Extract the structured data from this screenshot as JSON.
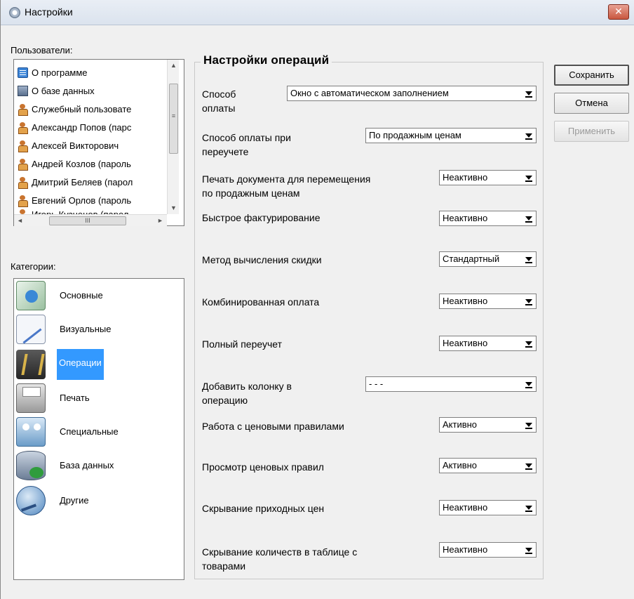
{
  "window": {
    "title": "Настройки",
    "close_icon": "close-icon",
    "close_glyph": "✕",
    "colors": {
      "selected_category": "#3399ff",
      "close_button": "#c9573f"
    }
  },
  "users": {
    "label": "Пользователи:",
    "items": [
      {
        "text": "О программе",
        "icon": "app-icon"
      },
      {
        "text": "О базе данных",
        "icon": "database-icon"
      },
      {
        "text": "Служебный пользовате",
        "icon": "user-icon"
      },
      {
        "text": "Александр Попов (парс",
        "icon": "user-icon"
      },
      {
        "text": "Алексей Викторович",
        "icon": "user-icon"
      },
      {
        "text": "Андрей Козлов (пароль",
        "icon": "user-icon"
      },
      {
        "text": "Дмитрий Беляев (парол",
        "icon": "user-icon"
      },
      {
        "text": "Евгений Орлов (пароль",
        "icon": "user-icon"
      },
      {
        "text": "Игорь Кузнецов (парол",
        "icon": "user-icon"
      }
    ],
    "scroll_up": "▲",
    "scroll_down": "▼",
    "scroll_left": "◄",
    "scroll_right": "►",
    "hthumb_grip": "III",
    "vthumb_grip": "≡"
  },
  "categories": {
    "label": "Категории:",
    "items": [
      {
        "text": "Основные",
        "icon": "basic-settings-icon"
      },
      {
        "text": "Визуальные",
        "icon": "visual-settings-icon"
      },
      {
        "text": "Операции",
        "icon": "operations-icon",
        "selected": true
      },
      {
        "text": "Печать",
        "icon": "printer-icon"
      },
      {
        "text": "Специальные",
        "icon": "special-settings-icon"
      },
      {
        "text": "База данных",
        "icon": "database-icon"
      },
      {
        "text": "Другие",
        "icon": "other-settings-icon"
      }
    ]
  },
  "operations": {
    "title": "Настройки операций",
    "settings": [
      {
        "label": "Способ\nоплаты",
        "value": "Окно с автоматическом заполнением"
      },
      {
        "label": "Способ оплаты при\nпереучете",
        "value": "По продажным ценам"
      },
      {
        "label": "Печать документа для перемещения\nпо продажным ценам",
        "value": "Неактивно"
      },
      {
        "label": "Быстрое фактурирование",
        "value": "Неактивно"
      },
      {
        "label": "Метод вычисления скидки",
        "value": "Стандартный"
      },
      {
        "label": "Комбинированная оплата",
        "value": "Неактивно"
      },
      {
        "label": "Полный переучет",
        "value": "Неактивно"
      },
      {
        "label": "Добавить колонку в\nоперацию",
        "value": "- - -"
      },
      {
        "label": "Работа с ценовыми правилами",
        "value": "Активно"
      },
      {
        "label": "Просмотр ценовых правил",
        "value": "Активно"
      },
      {
        "label": "Скрывание приходных цен",
        "value": "Неактивно"
      },
      {
        "label": "Скрывание количеств в таблице с\nтоварами",
        "value": "Неактивно"
      }
    ]
  },
  "buttons": {
    "save": "Сохранить",
    "cancel": "Отмена",
    "apply": "Применить"
  }
}
